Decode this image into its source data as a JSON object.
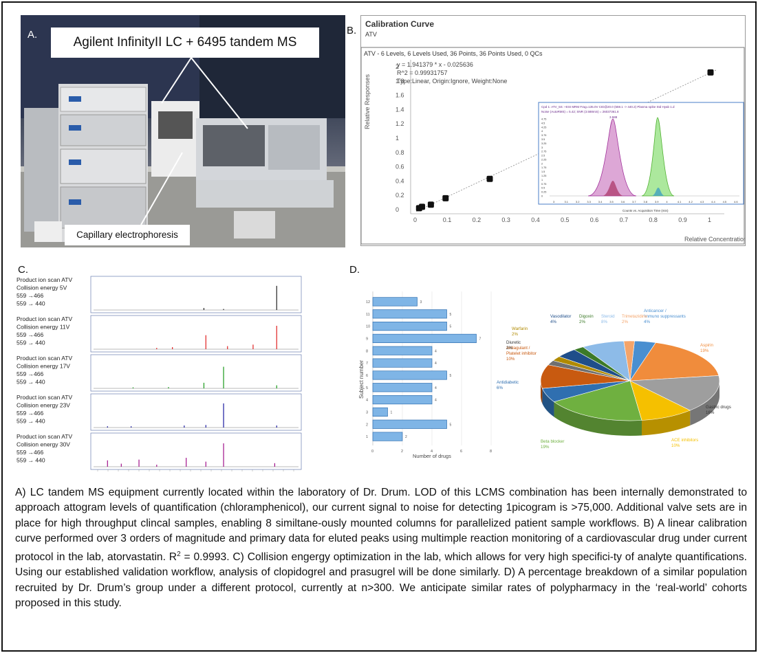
{
  "panelA": {
    "letter": "A.",
    "instrument_label": "Agilent InfinityII LC + 6495 tandem MS",
    "ce_label": "Capillary electrophoresis"
  },
  "panelB": {
    "letter": "B.",
    "title": "Calibration Curve",
    "subtitle": "ATV",
    "header": "ATV - 6 Levels, 6 Levels Used, 36 Points, 36 Points Used, 0 QCs",
    "eq1": "y = 1.941379 * x - 0.025636",
    "eq2": "R^2 = 0.99931757",
    "eq3": "Type:Linear, Origin:Ignore, Weight:None",
    "ylabel": "Relative Responses",
    "xlabel": "Relative Concentration",
    "x_ticks": [
      "0",
      "0.1",
      "0.2",
      "0.3",
      "0.4",
      "0.5",
      "0.6",
      "0.7",
      "0.8",
      "0.9",
      "1"
    ],
    "y_ticks": [
      "0",
      "0.2",
      "0.4",
      "0.6",
      "0.8",
      "1",
      "1.2",
      "1.4",
      "1.6",
      "1.8",
      "2"
    ],
    "inset_xlabel": "Counts vs. Acquisition Time (min)",
    "inset_x_ticks": [
      "3",
      "3.1",
      "3.2",
      "3.3",
      "3.4",
      "3.5",
      "3.6",
      "3.7",
      "3.8",
      "3.9",
      "4",
      "4.1",
      "4.2",
      "4.3",
      "4.4",
      "4.5",
      "4.6"
    ],
    "inset_y_ticks": [
      "4.75",
      "4.5",
      "4.25",
      "4",
      "3.75",
      "3.5",
      "3.25",
      "3",
      "2.75",
      "2.5",
      "2.25",
      "2",
      "1.75",
      "1.5",
      "1.25",
      "1",
      "0.75",
      "0.5",
      "0.25",
      "0"
    ],
    "points": [
      {
        "x": 0.01,
        "y": 0.02
      },
      {
        "x": 0.02,
        "y": 0.04
      },
      {
        "x": 0.05,
        "y": 0.07
      },
      {
        "x": 0.1,
        "y": 0.16
      },
      {
        "x": 0.25,
        "y": 0.43
      },
      {
        "x": 1.0,
        "y": 1.92
      }
    ]
  },
  "panelC": {
    "letter": "C.",
    "rows": [
      {
        "l1": "Product ion scan  ATV",
        "l2": "Collision energy 5V",
        "l3": "559 →466",
        "l4": "559 → 440",
        "color": "#222222"
      },
      {
        "l1": "Product ion scan  ATV",
        "l2": "Collision energy 11V",
        "l3": "559 →466",
        "l4": "559 → 440",
        "color": "#e02020"
      },
      {
        "l1": "Product ion scan  ATV",
        "l2": "Collision energy 17V",
        "l3": "559 →466",
        "l4": "559 → 440",
        "color": "#1a9a1a"
      },
      {
        "l1": "Product ion scan  ATV",
        "l2": "Collision energy 23V",
        "l3": "559 →466",
        "l4": "559 → 440",
        "color": "#1a1aa0"
      },
      {
        "l1": "Product ion scan  ATV",
        "l2": "Collision energy 30V",
        "l3": "559 →466",
        "l4": "559 → 440",
        "color": "#a0108a"
      }
    ]
  },
  "panelD": {
    "letter": "D.",
    "bar_chart": {
      "type": "bar",
      "orientation": "horizontal",
      "ylabel": "Subject number",
      "xlabel": "Number of drugs",
      "categories": [
        "1",
        "2",
        "3",
        "4",
        "5",
        "6",
        "7",
        "8",
        "9",
        "10",
        "11",
        "12"
      ],
      "values": [
        2,
        5,
        1,
        4,
        4,
        5,
        4,
        4,
        7,
        5,
        5,
        3
      ],
      "x_ticks": [
        "0",
        "2",
        "4",
        "6",
        "8"
      ],
      "xlim": [
        0,
        8
      ]
    },
    "pie_chart": {
      "type": "pie",
      "slices": [
        {
          "label": "Anticancer / Immuno suppressants",
          "pct": "4%",
          "value": 4,
          "color": "#4a8fd0"
        },
        {
          "label": "Aspirin",
          "pct": "19%",
          "value": 19,
          "color": "#f08c3c"
        },
        {
          "label": "Gastric drugs",
          "pct": "16%",
          "value": 16,
          "color": "#9e9e9e"
        },
        {
          "label": "ACE inhibitors",
          "pct": "10%",
          "value": 10,
          "color": "#f5c000"
        },
        {
          "label": "Beta blocker",
          "pct": "19%",
          "value": 19,
          "color": "#6fb040"
        },
        {
          "label": "Antidiabetic",
          "pct": "6%",
          "value": 6,
          "color": "#2f6fb0"
        },
        {
          "label": "Antiagulant / Platelet inhibitor",
          "pct": "10%",
          "value": 10,
          "color": "#c85a10"
        },
        {
          "label": "Diuretic",
          "pct": "2%",
          "value": 2,
          "color": "#707070"
        },
        {
          "label": "Warfarin",
          "pct": "2%",
          "value": 2,
          "color": "#b08a00"
        },
        {
          "label": "Vasodilator",
          "pct": "4%",
          "value": 4,
          "color": "#1f4e8a"
        },
        {
          "label": "Digoxin",
          "pct": "2%",
          "value": 2,
          "color": "#3c7a28"
        },
        {
          "label": "Steroid",
          "pct": "8%",
          "value": 8,
          "color": "#8dbbe8"
        },
        {
          "label": "Trimetazidine",
          "pct": "2%",
          "value": 2,
          "color": "#f4a46a"
        }
      ]
    }
  },
  "caption": {
    "text_a": "A) LC tandem MS equipment currently located within the laboratory of Dr. Drum. LOD of this LCMS combination has been internally demonstrated to approach attogram levels of quantification (chloramphenicol), our current signal to noise for detecting 1picogram is >75,000. Additional valve sets are in place for high throughput clincal samples, enabling 8 similtane-ously mounted columns for parallelized patient sample workflows. B) A linear calibration curve performed over 3 orders of magnitude and primary data for eluted peaks using multimple reaction monitoring of a cardiovascular drug under current protocol in the lab, atorvastatin. R",
    "sup": "2",
    "text_b": " = 0.9993. C) Collision engergy optimization in the lab, which allows for very high specifici-ty of analyte quantifications. Using our established validation workflow, analysis of clopidogrel and prasugrel will be done similarly. D) A percentage breakdown of a similar population recruited by Dr. Drum’s group under a different protocol, currently at n>300. We anticipate similar rates of polypharmacy in the ‘real-world’ cohorts proposed in this study."
  }
}
